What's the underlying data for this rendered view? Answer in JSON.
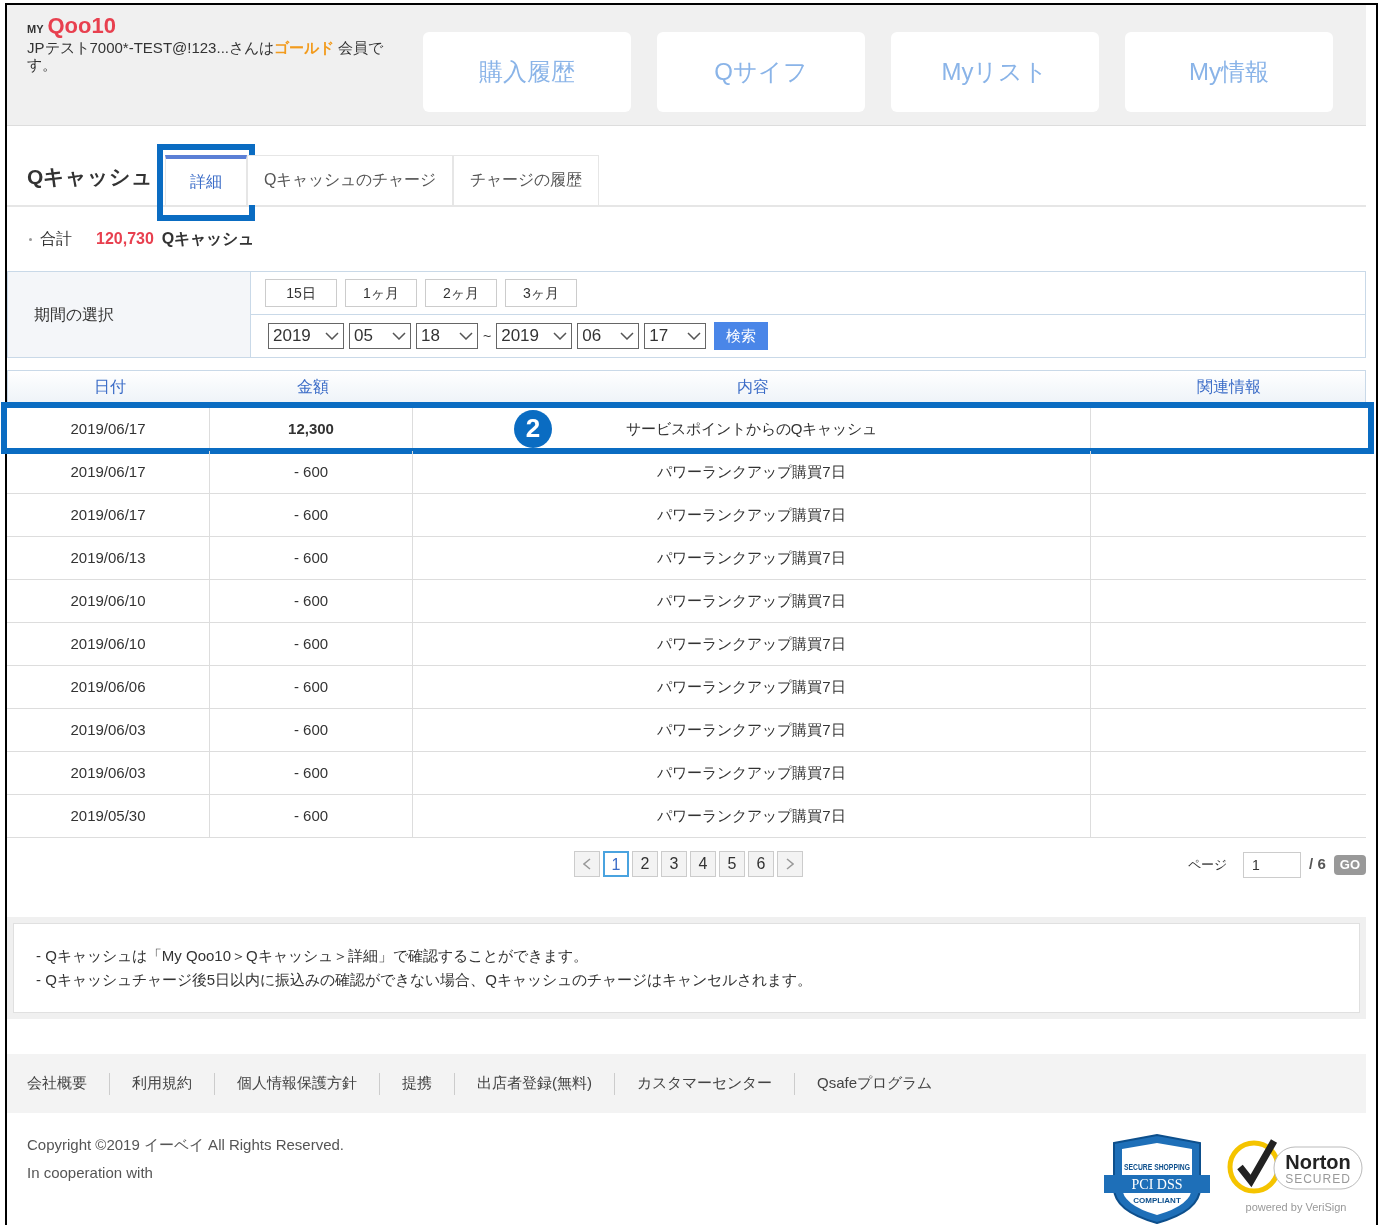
{
  "header": {
    "logo": {
      "my": "MY",
      "brand": "Qoo10"
    },
    "greeting": {
      "name": "JPテスト7000*-TEST@!123...さんは",
      "grade": "ゴールド",
      "suffix": " 会員です。"
    },
    "nav_buttons": [
      "購入履歴",
      "Qサイフ",
      "Myリスト",
      "My情報"
    ]
  },
  "section_title": "Qキャッシュ",
  "tabs": [
    {
      "label": "詳細",
      "selected": true,
      "highlighted": true
    },
    {
      "label": "Qキャッシュのチャージ",
      "selected": false,
      "highlighted": false
    },
    {
      "label": "チャージの履歴",
      "selected": false,
      "highlighted": false
    }
  ],
  "total": {
    "label": "合計",
    "amount": "120,730",
    "unit": "Qキャッシュ"
  },
  "period": {
    "label": "期間の選択",
    "quick_buttons": [
      "15日",
      "1ヶ月",
      "2ヶ月",
      "3ヶ月"
    ],
    "from": [
      "2019",
      "05",
      "18"
    ],
    "separator": "~",
    "to": [
      "2019",
      "06",
      "17"
    ],
    "search_button": "検索"
  },
  "table": {
    "columns": [
      "日付",
      "金額",
      "内容",
      "関連情報"
    ],
    "rows": [
      {
        "date": "2019/06/17",
        "amount": "12,300",
        "bold": true,
        "content": "サービスポイントからのQキャッシュ",
        "highlighted": true,
        "marker": "2"
      },
      {
        "date": "2019/06/17",
        "amount": "- 600",
        "bold": false,
        "content": "パワーランクアップ購買7日",
        "highlighted": false
      },
      {
        "date": "2019/06/17",
        "amount": "- 600",
        "bold": false,
        "content": "パワーランクアップ購買7日",
        "highlighted": false
      },
      {
        "date": "2019/06/13",
        "amount": "- 600",
        "bold": false,
        "content": "パワーランクアップ購買7日",
        "highlighted": false
      },
      {
        "date": "2019/06/10",
        "amount": "- 600",
        "bold": false,
        "content": "パワーランクアップ購買7日",
        "highlighted": false
      },
      {
        "date": "2019/06/10",
        "amount": "- 600",
        "bold": false,
        "content": "パワーランクアップ購買7日",
        "highlighted": false
      },
      {
        "date": "2019/06/06",
        "amount": "- 600",
        "bold": false,
        "content": "パワーランクアップ購買7日",
        "highlighted": false
      },
      {
        "date": "2019/06/03",
        "amount": "- 600",
        "bold": false,
        "content": "パワーランクアップ購買7日",
        "highlighted": false
      },
      {
        "date": "2019/06/03",
        "amount": "- 600",
        "bold": false,
        "content": "パワーランクアップ購買7日",
        "highlighted": false
      },
      {
        "date": "2019/05/30",
        "amount": "- 600",
        "bold": false,
        "content": "パワーランクアップ購買7日",
        "highlighted": false
      }
    ]
  },
  "pagination": {
    "pages": [
      {
        "label": "1",
        "selected": true
      },
      {
        "label": "2",
        "selected": false
      },
      {
        "label": "3",
        "selected": false
      },
      {
        "label": "4",
        "selected": false
      },
      {
        "label": "5",
        "selected": false
      },
      {
        "label": "6",
        "selected": false
      }
    ],
    "page_label": "ページ",
    "page_input": "1",
    "total": "/ 6",
    "go": "GO"
  },
  "notes": [
    "- Qキャッシュは「My Qoo10＞Qキャッシュ＞詳細」で確認することができます。",
    "- Qキャッシュチャージ後5日以内に振込みの確認ができない場合、Qキャッシュのチャージはキャンセルされます。"
  ],
  "footer": {
    "links": [
      "会社概要",
      "利用規約",
      "個人情報保護方針",
      "提携",
      "出店者登録(無料)",
      "カスタマーセンター",
      "Qsafeプログラム"
    ],
    "copyright": "Copyright ©2019 イーベイ All Rights Reserved.",
    "cooperation": "In cooperation with",
    "pci_badge": {
      "top": "SECURE SHOPPING",
      "main": "PCI DSS",
      "bottom": "COMPLIANT"
    },
    "norton_badge": {
      "name": "Norton",
      "status": "SECURED",
      "powered": "powered by VeriSign"
    }
  }
}
